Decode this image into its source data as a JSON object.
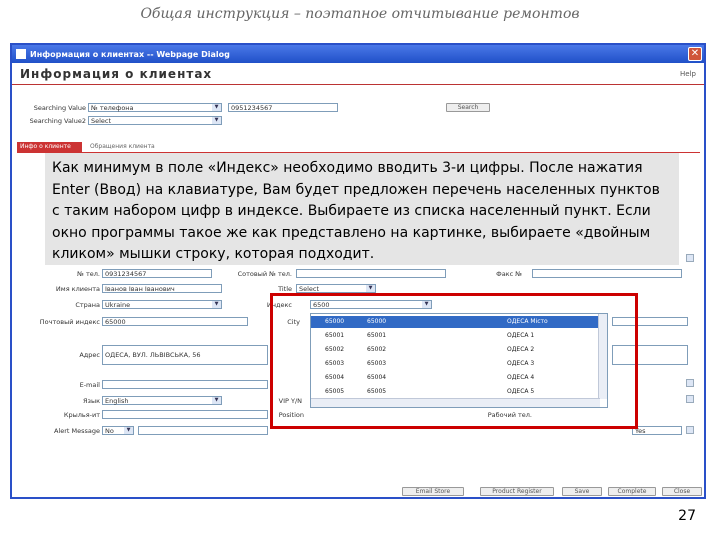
{
  "slide_title": "Общая инструкция – поэтапное отчитывание ремонтов",
  "window": {
    "title": "Информация о клиентах -- Webpage Dialog",
    "close": "✕"
  },
  "header": {
    "title": "Информация о клиентах",
    "help": "Help"
  },
  "search": {
    "label1": "Searching Value",
    "select1": "№ телефона",
    "input1": "0951234567",
    "button": "Search",
    "label2": "Searching Value2",
    "select2": "Select"
  },
  "tabs": {
    "active": "Инфо о клиенте",
    "other": "Обращения клиента"
  },
  "callout": "Как минимум в поле «Индекс» необходимо вводить 3-и цифры. После нажатия Enter (Ввод) на клавиатуре, Вам будет предложен перечень населенных пунктов с таким набором цифр в индексе. Выбираете из списка населенный пункт. Если окно программы такое же как представлено на картинке, выбираете «двойным кликом» мышки строку, которая подходит.",
  "form": {
    "phone_label": "№ тел.",
    "phone_value": "0931234567",
    "mobile_label": "Сотовый № тел.",
    "fax_label": "Факс №",
    "name_label": "Имя клиента",
    "name_value": "Іванов Іван Іванович",
    "title_label": "Title",
    "title_value": "Select",
    "country_label": "Страна",
    "country_value": "Ukraine",
    "index_label": "Индекс",
    "index_value": "6500",
    "postal_label": "Почтовый индекс",
    "postal_value": "65000",
    "city_label": "City",
    "address_label": "Адрес",
    "address_value": "ОДЕСА, ВУЛ. ЛЬВІВСЬКА, 56",
    "email_label": "E-mail",
    "lang_label": "Язык",
    "lang_value": "English",
    "vip_label": "VIP Y/N",
    "work_label": "Крылья-ит",
    "position_label": "Position",
    "worktel_label": "Рабочий тел.",
    "alert_label": "Alert Message",
    "alert_value": "No",
    "yes_value": "Yes"
  },
  "dropdown": {
    "rows": [
      {
        "a": "65000",
        "b": "65000",
        "c": "ОДЕСА Місто"
      },
      {
        "a": "65001",
        "b": "65001",
        "c": "ОДЕСА 1"
      },
      {
        "a": "65002",
        "b": "65002",
        "c": "ОДЕСА 2"
      },
      {
        "a": "65003",
        "b": "65003",
        "c": "ОДЕСА 3"
      },
      {
        "a": "65004",
        "b": "65004",
        "c": "ОДЕСА 4"
      },
      {
        "a": "65005",
        "b": "65005",
        "c": "ОДЕСА 5"
      }
    ]
  },
  "buttons": [
    "Email Store",
    "Product Register",
    "Save",
    "Complete",
    "Close"
  ],
  "page_number": "27"
}
